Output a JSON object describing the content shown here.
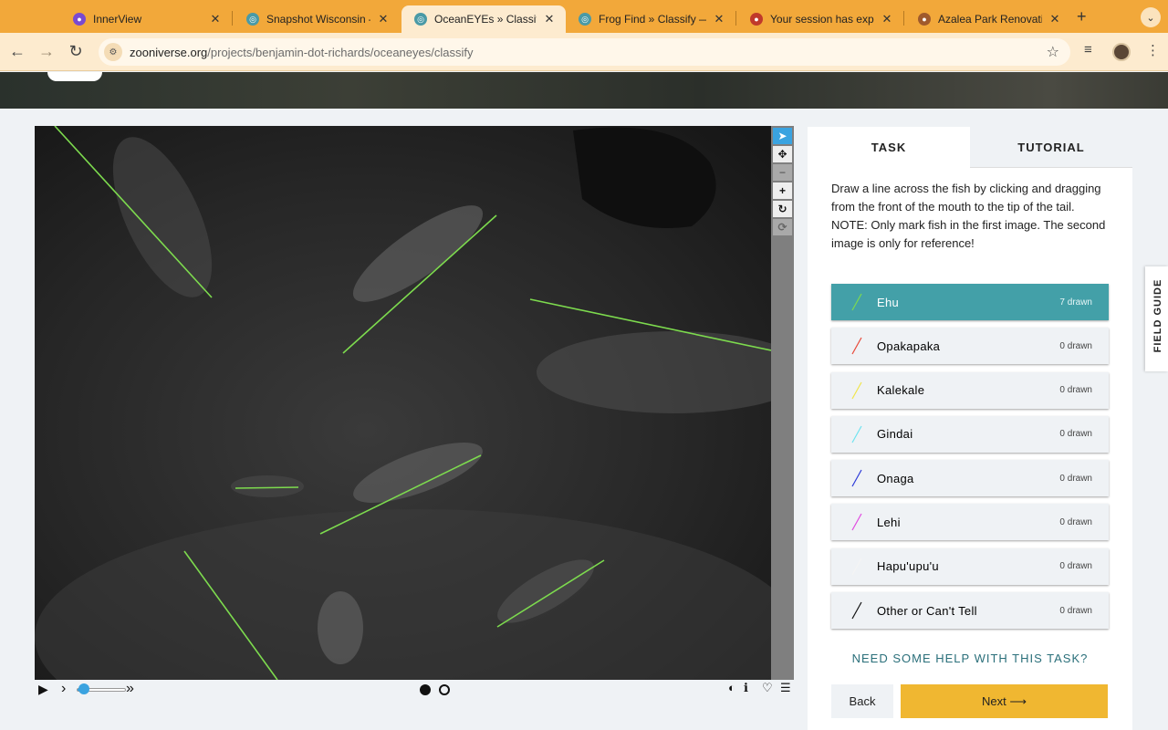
{
  "browser": {
    "tabs": [
      {
        "title": "InnerView",
        "favicon_color": "#7a4ad0"
      },
      {
        "title": "Snapshot Wisconsin — Z",
        "favicon_color": "#4a9aa6"
      },
      {
        "title": "OceanEYEs » Classify — ",
        "favicon_color": "#4a9aa6",
        "active": true
      },
      {
        "title": "Frog Find » Classify — Z",
        "favicon_color": "#4a9aa6"
      },
      {
        "title": "Your session has expired",
        "favicon_color": "#c0392b"
      },
      {
        "title": "Azalea Park Renovation",
        "favicon_color": "#a05a2c"
      }
    ],
    "url_domain": "zooniverse.org",
    "url_path": "/projects/benjamin-dot-richards/oceaneyes/classify"
  },
  "task_panel": {
    "tabs": [
      {
        "label": "TASK"
      },
      {
        "label": "TUTORIAL"
      }
    ],
    "instruction_line1": "Draw a line across the fish by clicking and dragging from the front of the mouth to the tip of the tail.",
    "instruction_line2": "NOTE: Only mark fish in the first image. The second image is only for reference!",
    "choices": [
      {
        "label": "Ehu",
        "count": "7 drawn",
        "color": "#7ddb4e",
        "selected": true
      },
      {
        "label": "Opakapaka",
        "count": "0 drawn",
        "color": "#e84a3a"
      },
      {
        "label": "Kalekale",
        "count": "0 drawn",
        "color": "#f0e54a"
      },
      {
        "label": "Gindai",
        "count": "0 drawn",
        "color": "#6fe3f0"
      },
      {
        "label": "Onaga",
        "count": "0 drawn",
        "color": "#2c3ad8"
      },
      {
        "label": "Lehi",
        "count": "0 drawn",
        "color": "#e04ae0"
      },
      {
        "label": "Hapu'upu'u",
        "count": "0 drawn",
        "color": "#f4f4f4"
      },
      {
        "label": "Other or Can't Tell",
        "count": "0 drawn",
        "color": "#111111"
      }
    ],
    "help_link": "NEED SOME HELP WITH THIS TASK?",
    "back_label": "Back",
    "next_label": "Next ⟶"
  },
  "field_guide_label": "FIELD GUIDE",
  "subject_viewer": {
    "line_color": "#7ddb4e",
    "tools": [
      "cursor-icon",
      "move-icon",
      "zoom-out-icon",
      "zoom-in-icon",
      "rotate-icon",
      "reset-icon"
    ],
    "frame_count": 2,
    "current_frame": 1
  }
}
